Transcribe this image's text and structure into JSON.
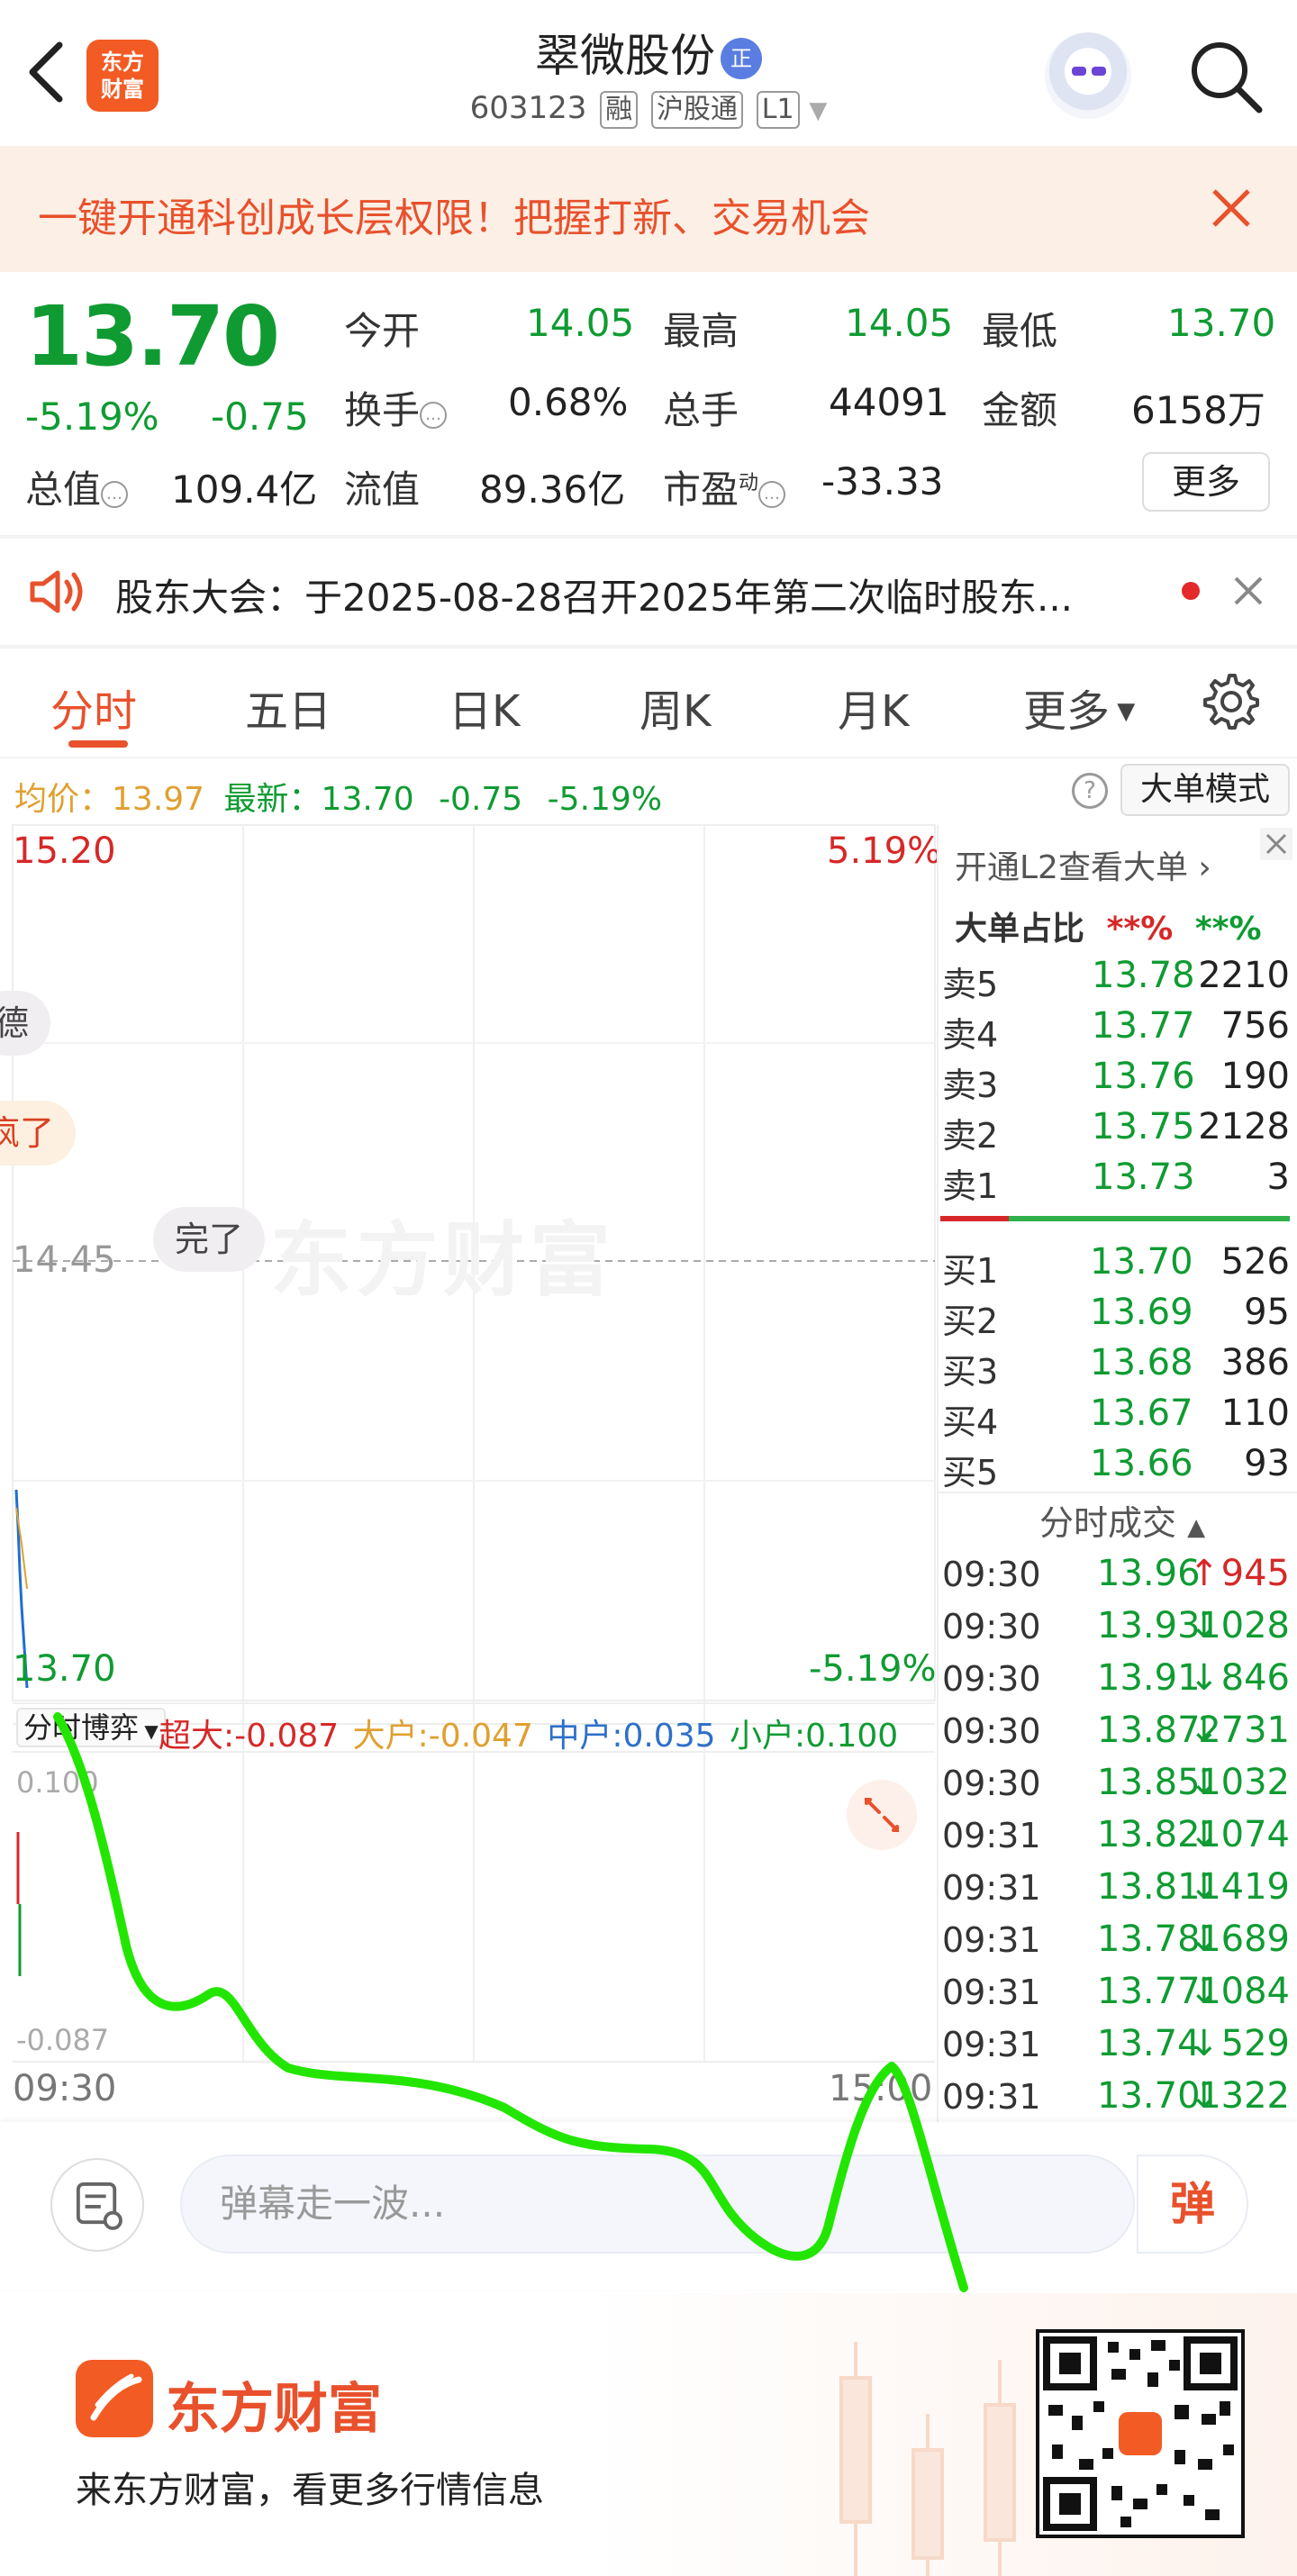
{
  "header": {
    "stock_name": "翠微股份",
    "name_tag": "正",
    "code": "603123",
    "tags": [
      "融",
      "沪股通",
      "L1"
    ],
    "logo_text_1": "东方",
    "logo_text_2": "财富"
  },
  "promo": {
    "text": "一键开通科创成长层权限！把握打新、交易机会"
  },
  "quote": {
    "price": "13.70",
    "change_pct": "-5.19%",
    "change": "-0.75",
    "open_label": "今开",
    "open": "14.05",
    "high_label": "最高",
    "high": "14.05",
    "low_label": "最低",
    "low": "13.70",
    "turnover_label": "换手",
    "turnover": "0.68%",
    "volume_label": "总手",
    "volume": "44091",
    "amount_label": "金额",
    "amount": "6158万",
    "total_cap_label": "总值",
    "total_cap": "109.4亿",
    "float_cap_label": "流值",
    "float_cap": "89.36亿",
    "pe_label": "市盈",
    "pe_sup": "动",
    "pe": "-33.33",
    "more_label": "更多"
  },
  "notice": {
    "text": "股东大会：于2025-08-28召开2025年第二次临时股东..."
  },
  "tabs": [
    "分时",
    "五日",
    "日K",
    "周K",
    "月K",
    "更多"
  ],
  "chart_info": {
    "avg_label": "均价：",
    "avg_value": "13.97",
    "latest_label": "最新：",
    "latest_value": "13.70",
    "latest_change": "-0.75",
    "latest_pct": "-5.19%",
    "big_mode_label": "大单模式",
    "help_icon": "?"
  },
  "chart": {
    "top_price": "15.20",
    "top_pct": "5.19%",
    "mid_price": "14.45",
    "bottom_price": "13.70",
    "bottom_pct": "-5.19%",
    "time_start": "09:30",
    "time_end": "15:00",
    "bubbles": [
      "德",
      "疯了",
      "完了"
    ],
    "watermark": "东方财富",
    "flow_selector": "分时博弈",
    "flow_super_label": "超大:",
    "flow_super": "-0.087",
    "flow_big_label": "大户:",
    "flow_big": "-0.047",
    "flow_mid_label": "中户:",
    "flow_mid": "0.035",
    "flow_small_label": "小户:",
    "flow_small": "0.100",
    "flow_top": "0.100",
    "flow_bottom": "-0.087"
  },
  "panel": {
    "l2_link": "开通L2查看大单",
    "big_ratio_label": "大单占比",
    "big_ratio_red": "**%",
    "big_ratio_green": "**%",
    "asks": [
      {
        "label": "卖5",
        "price": "13.78",
        "vol": "2210"
      },
      {
        "label": "卖4",
        "price": "13.77",
        "vol": "756"
      },
      {
        "label": "卖3",
        "price": "13.76",
        "vol": "190"
      },
      {
        "label": "卖2",
        "price": "13.75",
        "vol": "2128"
      },
      {
        "label": "卖1",
        "price": "13.73",
        "vol": "3"
      }
    ],
    "bids": [
      {
        "label": "买1",
        "price": "13.70",
        "vol": "526"
      },
      {
        "label": "买2",
        "price": "13.69",
        "vol": "95"
      },
      {
        "label": "买3",
        "price": "13.68",
        "vol": "386"
      },
      {
        "label": "买4",
        "price": "13.67",
        "vol": "110"
      },
      {
        "label": "买5",
        "price": "13.66",
        "vol": "93"
      }
    ],
    "ticks_title": "分时成交",
    "ticks": [
      {
        "time": "09:30",
        "price": "13.96",
        "dir": "↑",
        "vol": "945"
      },
      {
        "time": "09:30",
        "price": "13.93",
        "dir": "↓",
        "vol": "1028"
      },
      {
        "time": "09:30",
        "price": "13.91",
        "dir": "↓",
        "vol": "846"
      },
      {
        "time": "09:30",
        "price": "13.87",
        "dir": "↓",
        "vol": "2731"
      },
      {
        "time": "09:30",
        "price": "13.85",
        "dir": "↓",
        "vol": "1032"
      },
      {
        "time": "09:31",
        "price": "13.82",
        "dir": "↓",
        "vol": "1074"
      },
      {
        "time": "09:31",
        "price": "13.81",
        "dir": "↓",
        "vol": "1419"
      },
      {
        "time": "09:31",
        "price": "13.78",
        "dir": "↓",
        "vol": "1689"
      },
      {
        "time": "09:31",
        "price": "13.77",
        "dir": "↓",
        "vol": "1084"
      },
      {
        "time": "09:31",
        "price": "13.74",
        "dir": "↓",
        "vol": "529"
      },
      {
        "time": "09:31",
        "price": "13.70",
        "dir": "↓",
        "vol": "1322"
      }
    ]
  },
  "danmu": {
    "placeholder": "弹幕走一波...",
    "send_label": "弹"
  },
  "footer": {
    "brand": "东方财富",
    "slogan": "来东方财富，看更多行情信息"
  },
  "colors": {
    "accent": "#e8512c",
    "up": "#d62828",
    "down": "#0f9b32",
    "annotation": "#22e600"
  }
}
